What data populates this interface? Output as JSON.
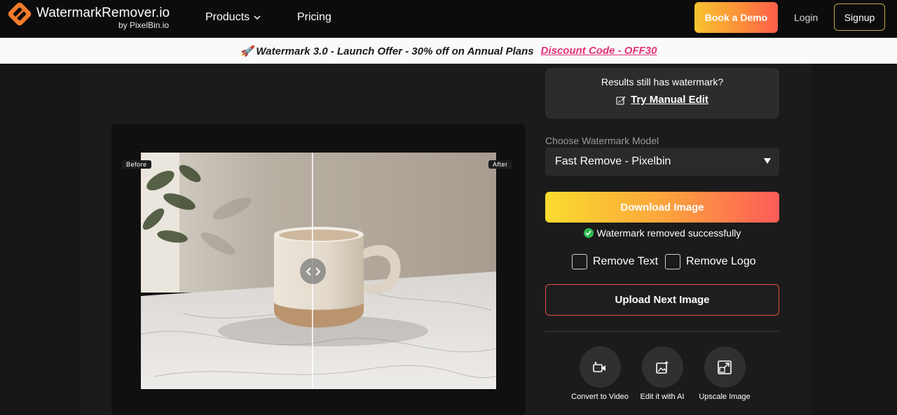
{
  "brand": {
    "name": "WatermarkRemover.io",
    "sub": "by PixelBin.io"
  },
  "nav": {
    "products": "Products",
    "pricing": "Pricing",
    "book_demo": "Book a Demo",
    "login": "Login",
    "signup": "Signup"
  },
  "promo": {
    "text": "🚀 Watermark 3.0 - Launch Offer - 30% off on Annual Plans",
    "code": "Discount Code - OFF30"
  },
  "preview": {
    "before": "Before",
    "after": "After"
  },
  "manual": {
    "question": "Results still has watermark?",
    "link": "Try Manual Edit"
  },
  "model": {
    "label": "Choose Watermark Model",
    "selected": "Fast Remove - Pixelbin"
  },
  "actions": {
    "download": "Download Image",
    "success": "Watermark removed successfully",
    "remove_text": "Remove Text",
    "remove_logo": "Remove Logo",
    "upload_next": "Upload Next Image"
  },
  "tools": [
    {
      "label": "Convert to Video",
      "icon": "video-sparkle-icon"
    },
    {
      "label": "Edit it with AI",
      "icon": "image-sparkle-icon"
    },
    {
      "label": "Upscale Image",
      "icon": "upscale-icon"
    }
  ],
  "colors": {
    "accent_start": "#f9dc2e",
    "accent_end": "#fd5c58",
    "promo_code": "#e3327a",
    "success": "#2db84e"
  }
}
